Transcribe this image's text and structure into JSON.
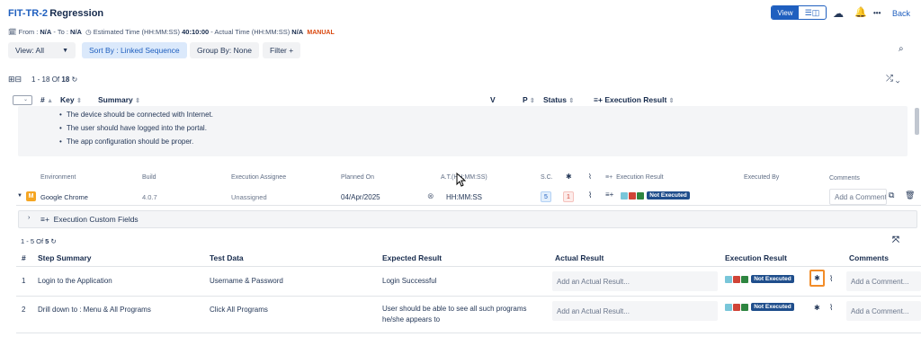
{
  "header": {
    "test_key": "FIT-TR-2",
    "test_name": "Regression",
    "from_label": "From :",
    "from_value": "N/A",
    "to_label": "- To :",
    "to_value": "N/A",
    "estimated_label": "Estimated Time (HH:MM:SS)",
    "estimated_value": "40:10:00",
    "actual_label": "- Actual Time (HH:MM:SS)",
    "actual_value": "N/A",
    "mode_badge": "MANUAL",
    "view_label": "View",
    "back_label": "Back",
    "more_label": "•••"
  },
  "toolbar": {
    "view_select": "View: All",
    "sort_by": "Sort By : Linked Sequence",
    "group_by": "Group By: None",
    "filter": "Filter +"
  },
  "pagination_top": {
    "range": "1 - 18",
    "of": "Of",
    "total": "18"
  },
  "table_headers": {
    "hash": "#",
    "key": "Key",
    "summary": "Summary",
    "v": "V",
    "p": "P",
    "status": "Status",
    "execution_result": "Execution Result"
  },
  "preconditions": [
    "The device should be connected with Internet.",
    "The user should have logged into the portal.",
    "The app configuration should be proper."
  ],
  "execution_headers": {
    "environment": "Environment",
    "build": "Build",
    "assignee": "Execution Assignee",
    "planned_on": "Planned On",
    "at": "A.T.(HH:MM:SS)",
    "sc": "S.C.",
    "execution_result": "Execution Result",
    "executed_by": "Executed By",
    "comments": "Comments"
  },
  "execution_row": {
    "environment": "Google Chrome",
    "build": "4.0.7",
    "assignee": "Unassigned",
    "planned_on": "04/Apr/2025",
    "at": "HH:MM:SS",
    "sc": "5",
    "defects": "1",
    "result_badge": "Not Executed",
    "comment_placeholder": "Add a Comment"
  },
  "custom_fields_label": "Execution Custom Fields",
  "pagination_steps": {
    "range": "1 - 5",
    "of": "Of",
    "total": "5"
  },
  "step_headers": {
    "hash": "#",
    "summary": "Step Summary",
    "test_data": "Test Data",
    "expected": "Expected Result",
    "actual": "Actual Result",
    "execution_result": "Execution Result",
    "comments": "Comments"
  },
  "steps": [
    {
      "num": "1",
      "summary": "Login to the Application",
      "test_data": "Username & Password",
      "expected": "Login Successful",
      "actual_placeholder": "Add an Actual Result...",
      "result_badge": "Not Executed",
      "comment_placeholder": "Add a Comment..."
    },
    {
      "num": "2",
      "summary": "Drill down to : Menu & All Programs",
      "test_data": "Click All Programs",
      "expected": "User should be able to see all such programs he/she appears to",
      "actual_placeholder": "Add an Actual Result...",
      "result_badge": "Not Executed",
      "comment_placeholder": "Add a Comment..."
    }
  ],
  "colors": {
    "brand_blue": "#1f5fbf",
    "status_teal": "#79c6d9",
    "status_red": "#d04437",
    "status_green": "#2e8540",
    "badge_navy": "#1f4e8c",
    "highlight_orange": "#f28c28"
  }
}
